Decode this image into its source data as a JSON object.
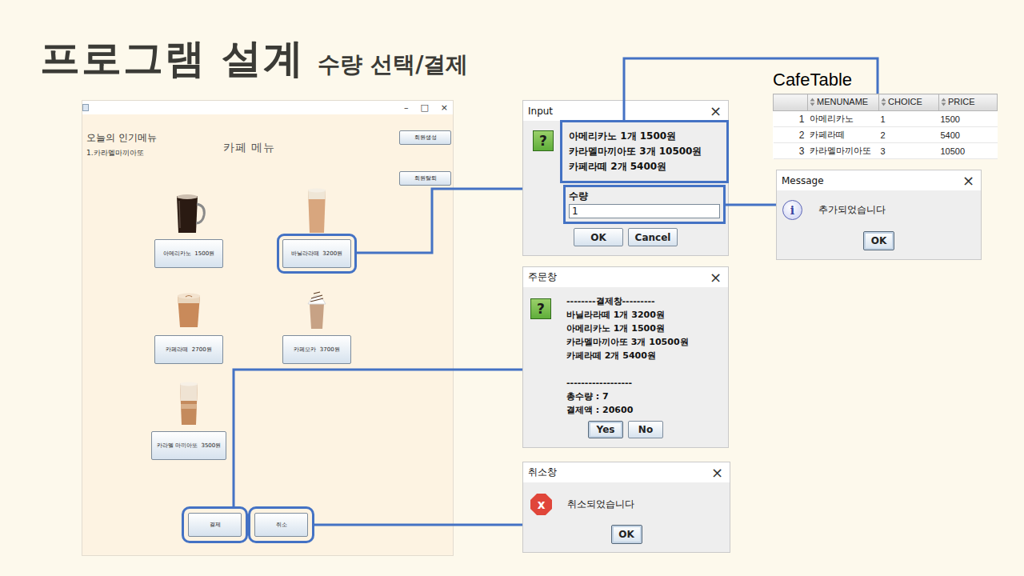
{
  "slide": {
    "title": "프로그램 설계",
    "subtitle": "수량 선택/결제"
  },
  "main_window": {
    "controls": [
      "–",
      "□",
      "×"
    ],
    "popular": {
      "heading": "오늘의 인기메뉴",
      "items": [
        "1.카라멜마끼아또"
      ]
    },
    "menu_title": "카페 메뉴",
    "member_buttons": [
      "회원생성",
      "회원탈퇴"
    ],
    "menu_items": [
      {
        "label": "아메리카노  1500원",
        "kind": "mug",
        "highlighted": false
      },
      {
        "label": "바닐라라떼  3200원",
        "kind": "tall",
        "highlighted": true
      },
      {
        "label": "카페라떼  2700원",
        "kind": "cup",
        "highlighted": false
      },
      {
        "label": "카페모카  3700원",
        "kind": "whipped",
        "highlighted": false
      },
      {
        "label": "카라멜 마끼아또  3500원",
        "kind": "layered",
        "highlighted": false
      }
    ],
    "actions": [
      {
        "label": "결제",
        "highlighted": true
      },
      {
        "label": "취소",
        "highlighted": true
      }
    ]
  },
  "input_dialog": {
    "title": "Input",
    "close": "×",
    "icon": "?",
    "lines": [
      "아메리카노 1개 1500원",
      "카라멜마끼아또 3개 10500원",
      "카페라떼 2개 5400원"
    ],
    "lines_highlighted": true,
    "field_label": "수량",
    "field_value": "1",
    "field_highlighted": true,
    "buttons": [
      {
        "label": "OK",
        "focused": false
      },
      {
        "label": "Cancel",
        "focused": false
      }
    ]
  },
  "cafe_table": {
    "title": "CafeTable",
    "columns": [
      {
        "label": "MENUNAME",
        "sortable": true
      },
      {
        "label": "CHOICE",
        "sortable": true
      },
      {
        "label": "PRICE",
        "sortable": true
      }
    ],
    "rows": [
      {
        "index": "1",
        "cells": [
          "아메리카노",
          "1",
          "1500"
        ]
      },
      {
        "index": "2",
        "cells": [
          "카페라떼",
          "2",
          "5400"
        ]
      },
      {
        "index": "3",
        "cells": [
          "카라멜마끼아또",
          "3",
          "10500"
        ]
      }
    ]
  },
  "message_dialog": {
    "title": "Message",
    "close": "×",
    "icon": "i",
    "text": "추가되었습니다",
    "buttons": [
      {
        "label": "OK",
        "focused": true
      }
    ]
  },
  "order_dialog": {
    "title": "주문창",
    "close": "×",
    "icon": "?",
    "header": "--------결제창---------",
    "items": [
      "바닐라라떼 1개 3200원",
      "아메리카노 1개 1500원",
      "카라멜마끼아또 3개 10500원",
      "카페라떼 2개 5400원"
    ],
    "divider": "------------------",
    "total_qty": "총수량 : 7",
    "total_price": "결제액 : 20600",
    "buttons": [
      {
        "label": "Yes",
        "focused": true
      },
      {
        "label": "No",
        "focused": false
      }
    ]
  },
  "cancel_dialog": {
    "title": "취소창",
    "close": "×",
    "icon": "x",
    "text": "취소되었습니다",
    "buttons": [
      {
        "label": "OK",
        "focused": true
      }
    ]
  }
}
